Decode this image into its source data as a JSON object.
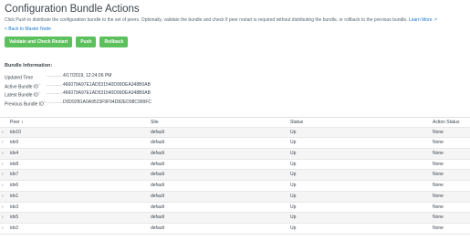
{
  "page": {
    "title": "Configuration Bundle Actions",
    "description": "Click Push to distribute the configuration bundle to the set of peers. Optionally, validate the bundle and check if peer restart is required without distributing the bundle, or rollback to the previous bundle.",
    "learn_more": "Learn More",
    "back_link": "< Back to Master Node"
  },
  "buttons": {
    "validate": "Validate and Check Restart",
    "push": "Push",
    "rollback": "Rollback"
  },
  "bundle_info": {
    "title": "Bundle Information:",
    "rows": [
      {
        "label": "Updated Time",
        "dots": "............................",
        "value": "4/17/2019, 12:24:06 PM",
        "sup": ""
      },
      {
        "label": "Active Bundle ID",
        "dots": "..........................",
        "value": "466079A97E1AD531540D99DEA348B0AB",
        "sup": "?"
      },
      {
        "label": "Latest Bundle ID",
        "dots": "..........................",
        "value": "466079A97E1AD531540D99DEA348B0AB",
        "sup": "?"
      },
      {
        "label": "Previous Bundle ID",
        "dots": "......................",
        "value": "D0D92B1A0A9523F9F94D82ED98C999FC",
        "sup": "?"
      }
    ]
  },
  "table": {
    "headers": {
      "peer": "Peer ↕",
      "site": "Site",
      "status": "Status",
      "action_status": "Action Status"
    },
    "expand_glyph": "›",
    "rows": [
      {
        "peer": "idx10",
        "site": "default",
        "status": "Up",
        "action": "None"
      },
      {
        "peer": "idx9",
        "site": "default",
        "status": "Up",
        "action": "None"
      },
      {
        "peer": "idx4",
        "site": "default",
        "status": "Up",
        "action": "None"
      },
      {
        "peer": "idx8",
        "site": "default",
        "status": "Up",
        "action": "None"
      },
      {
        "peer": "idx7",
        "site": "default",
        "status": "Up",
        "action": "None"
      },
      {
        "peer": "idx6",
        "site": "default",
        "status": "Up",
        "action": "None"
      },
      {
        "peer": "idx1",
        "site": "default",
        "status": "Up",
        "action": "None"
      },
      {
        "peer": "idx3",
        "site": "default",
        "status": "Up",
        "action": "None"
      },
      {
        "peer": "idx5",
        "site": "default",
        "status": "Up",
        "action": "None"
      },
      {
        "peer": "idx2",
        "site": "default",
        "status": "Up",
        "action": "None"
      }
    ]
  }
}
